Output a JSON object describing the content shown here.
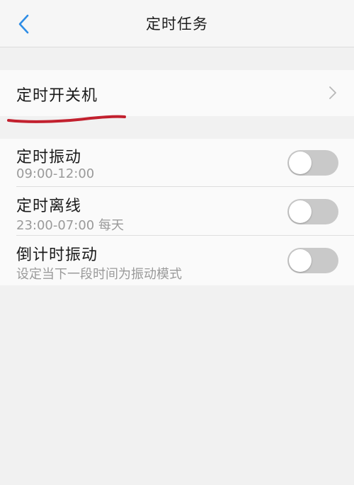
{
  "header": {
    "title": "定时任务",
    "back_icon": "chevron-left-icon",
    "accent_color": "#2e8de6"
  },
  "scheduled_power": {
    "label": "定时开关机",
    "chevron_icon": "chevron-right-icon"
  },
  "toggles": [
    {
      "title": "定时振动",
      "subtitle": "09:00-12:00",
      "enabled": false
    },
    {
      "title": "定时离线",
      "subtitle": "23:00-07:00 每天",
      "enabled": false
    },
    {
      "title": "倒计时振动",
      "subtitle": "设定当下一段时间为振动模式",
      "enabled": false
    }
  ],
  "colors": {
    "toggle_off": "#c9c9c9",
    "annotation": "#c2202e"
  }
}
